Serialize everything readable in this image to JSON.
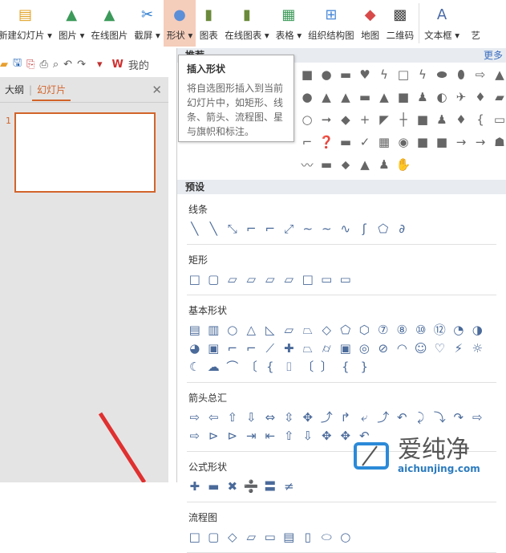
{
  "ribbon": [
    {
      "label": "新建幻灯片 ▾",
      "icon": "new-slide-icon",
      "glyph": "▤",
      "color": "#e0a020"
    },
    {
      "label": "图片 ▾",
      "icon": "picture-icon",
      "glyph": "▲",
      "color": "#3c9a5a"
    },
    {
      "label": "在线图片",
      "icon": "online-picture-icon",
      "glyph": "▲",
      "color": "#3c9a5a"
    },
    {
      "label": "截屏 ▾",
      "icon": "screenshot-icon",
      "glyph": "✂",
      "color": "#2a7bd0"
    },
    {
      "label": "形状 ▾",
      "icon": "shapes-icon",
      "glyph": "●",
      "color": "#5b8fd8",
      "active": true
    },
    {
      "label": "图表",
      "icon": "chart-icon",
      "glyph": "▮",
      "color": "#6a8a3a"
    },
    {
      "label": "在线图表 ▾",
      "icon": "online-chart-icon",
      "glyph": "▮",
      "color": "#6a8a3a"
    },
    {
      "label": "表格 ▾",
      "icon": "table-icon",
      "glyph": "▦",
      "color": "#3c9a5a"
    },
    {
      "label": "组织结构图",
      "icon": "org-chart-icon",
      "glyph": "⊞",
      "color": "#4a8ad8"
    },
    {
      "label": "地图",
      "icon": "map-icon",
      "glyph": "◆",
      "color": "#d84a4a"
    },
    {
      "label": "二维码",
      "icon": "qrcode-icon",
      "glyph": "▩",
      "color": "#444"
    },
    {
      "label": "文本框 ▾",
      "icon": "textbox-icon",
      "glyph": "A",
      "color": "#4a6aa8"
    },
    {
      "label": "艺",
      "icon": "art-text-icon",
      "glyph": "",
      "color": "#444"
    }
  ],
  "quickbar": {
    "app_label": "我的"
  },
  "left": {
    "tab_outline": "大纲",
    "tab_slides": "幻灯片",
    "slide_number": "1"
  },
  "panel": {
    "recommended": "推荐",
    "more": "更多",
    "preset": "预设",
    "rec_glyphs": [
      "■",
      "●",
      "▬",
      "♥",
      "ϟ",
      "□",
      "ϟ",
      "⬬",
      "⬮",
      "⇨",
      "▲",
      "●",
      "▲",
      "▲",
      "▬",
      "▲",
      "■",
      "♟",
      "◐",
      "✈",
      "♦",
      "▰",
      "○",
      "➞",
      "◆",
      "+",
      "◤",
      "┼",
      "■",
      "♟",
      "♦",
      "{",
      "▭",
      "⌐",
      "❓",
      "▬",
      "✓",
      "▦",
      "◉",
      "■",
      "■",
      "→",
      "→",
      "☗",
      "〰",
      "▬",
      "⬥",
      "▲",
      "♟",
      "✋"
    ],
    "sections": [
      {
        "title": "线条",
        "glyphs": [
          "╲",
          "╲",
          "⤡",
          "⌐",
          "⌐",
          "⤢",
          "∼",
          "∼",
          "∿",
          "ʃ",
          "⬠",
          "∂"
        ]
      },
      {
        "title": "矩形",
        "glyphs": [
          "□",
          "▢",
          "▱",
          "▱",
          "▱",
          "▱",
          "□",
          "▭",
          "▭"
        ]
      },
      {
        "title": "基本形状",
        "glyphs": [
          "▤",
          "▥",
          "○",
          "△",
          "◺",
          "▱",
          "⏢",
          "◇",
          "⬠",
          "⬡",
          "⑦",
          "⑧",
          "⑩",
          "⑫",
          "◔",
          "◑",
          "◕",
          "▣",
          "⌐",
          "⌐",
          "⟋",
          "✚",
          "⏢",
          "⌭",
          "▣",
          "◎",
          "⊘",
          "◠",
          "☺",
          "♡",
          "⚡",
          "☼",
          "☾",
          "☁",
          "⌒",
          "〔",
          "{",
          "⌷",
          "〔",
          "〕",
          "{",
          "}"
        ]
      },
      {
        "title": "箭头总汇",
        "glyphs": [
          "⇨",
          "⇦",
          "⇧",
          "⇩",
          "⇔",
          "⇳",
          "✥",
          "⤴",
          "↱",
          "⤶",
          "⤴",
          "↶",
          "⤸",
          "⤵",
          "↷",
          "⇨",
          "⇨",
          "⊳",
          "⊳",
          "⇥",
          "⇤",
          "⇧",
          "⇩",
          "✥",
          "✥",
          "↶"
        ]
      },
      {
        "title": "公式形状",
        "glyphs": [
          "✚",
          "▬",
          "✖",
          "➗",
          "〓",
          "≠"
        ]
      },
      {
        "title": "流程图",
        "glyphs": [
          "□",
          "▢",
          "◇",
          "▱",
          "▭",
          "▤",
          "▯",
          "⬭",
          "○"
        ]
      }
    ]
  },
  "tooltip": {
    "title": "插入形状",
    "desc": "将自选图形插入到当前幻灯片中，如矩形、线条、箭头、流程图、星与旗帜和标注。"
  },
  "watermark": {
    "cn": "爱纯净",
    "en": "aichunjing.com"
  }
}
